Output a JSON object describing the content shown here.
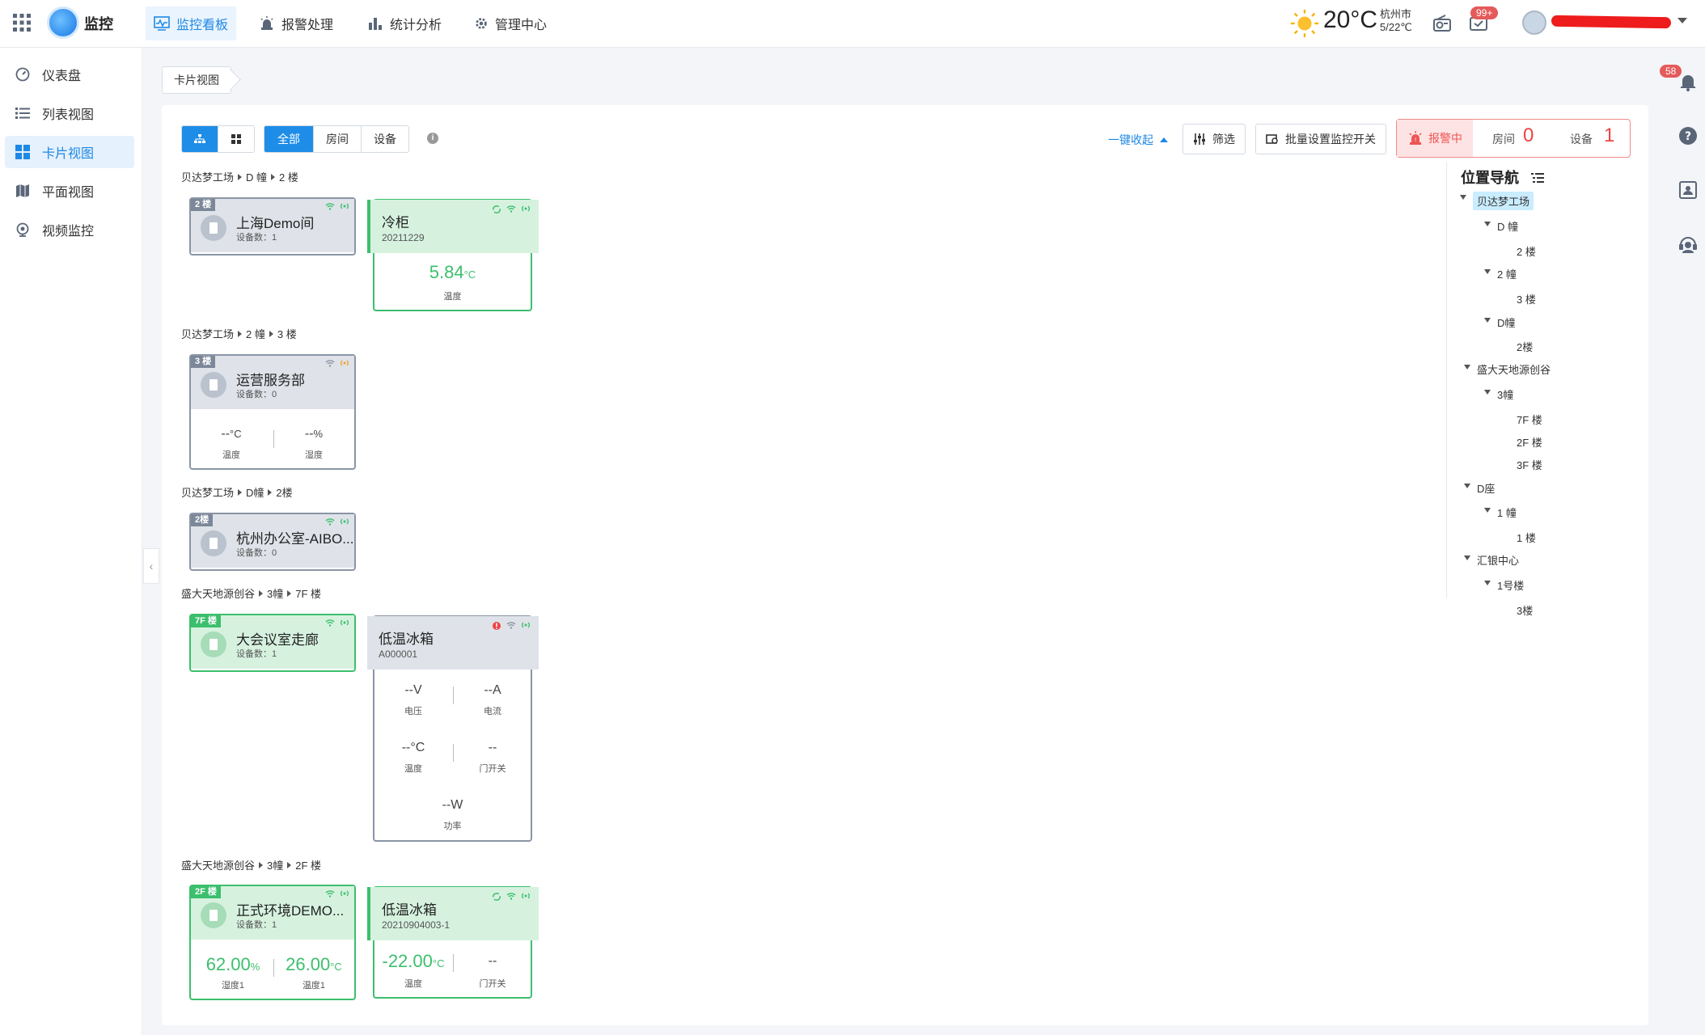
{
  "app": {
    "name": "监控"
  },
  "nav": {
    "items": [
      {
        "label": "监控看板",
        "active": true
      },
      {
        "label": "报警处理"
      },
      {
        "label": "统计分析"
      },
      {
        "label": "管理中心"
      }
    ]
  },
  "weather": {
    "temp": "20°C",
    "city": "杭州市",
    "range": "5/22℃"
  },
  "notifications": {
    "count": "99+",
    "rail_count": "58"
  },
  "sidebar": {
    "items": [
      {
        "label": "仪表盘"
      },
      {
        "label": "列表视图"
      },
      {
        "label": "卡片视图",
        "active": true
      },
      {
        "label": "平面视图"
      },
      {
        "label": "视频监控"
      }
    ]
  },
  "breadcrumb": {
    "tab": "卡片视图"
  },
  "toolbar": {
    "filters": [
      "全部",
      "房间",
      "设备"
    ],
    "collapse_all": "一键收起",
    "filter_btn": "筛选",
    "batch_btn": "批量设置监控开关",
    "alarm": {
      "label": "报警中",
      "room_label": "房间",
      "room_count": "0",
      "device_label": "设备",
      "device_count": "1"
    }
  },
  "groups": [
    {
      "path": [
        "贝达梦工场",
        "D 幢",
        "2 楼"
      ],
      "room": {
        "tag": "2 楼",
        "name": "上海Demo间",
        "devices": "设备数：1"
      },
      "device": {
        "name": "冷柜",
        "id": "20211229",
        "value": "5.84",
        "unit": "°C",
        "label": "温度"
      }
    },
    {
      "path": [
        "贝达梦工场",
        "2 幢",
        "3 楼"
      ],
      "room": {
        "tag": "3 楼",
        "name": "运营服务部",
        "devices": "设备数：0",
        "readings": [
          {
            "value": "--",
            "unit": "°C",
            "label": "温度"
          },
          {
            "value": "--",
            "unit": "%",
            "label": "湿度"
          }
        ]
      }
    },
    {
      "path": [
        "贝达梦工场",
        "D幢",
        "2楼"
      ],
      "room": {
        "tag": "2楼",
        "name": "杭州办公室-AIBO...",
        "devices": "设备数：0"
      }
    },
    {
      "path": [
        "盛大天地源创谷",
        "3幢",
        "7F 楼"
      ],
      "room": {
        "tag": "7F 楼",
        "name": "大会议室走廊",
        "devices": "设备数：1"
      },
      "device": {
        "name": "低温冰箱",
        "id": "A000001",
        "readings": [
          {
            "value": "--V",
            "label": "电压"
          },
          {
            "value": "--A",
            "label": "电流"
          },
          {
            "value": "--°C",
            "label": "温度"
          },
          {
            "value": "--",
            "label": "门开关"
          },
          {
            "value": "--W",
            "label": "功率"
          }
        ]
      }
    },
    {
      "path": [
        "盛大天地源创谷",
        "3幢",
        "2F 楼"
      ],
      "room": {
        "tag": "2F 楼",
        "name": "正式环境DEMO...",
        "devices": "设备数：1",
        "readings": [
          {
            "value": "62.00",
            "unit": "%",
            "label": "湿度1"
          },
          {
            "value": "26.00",
            "unit": "°C",
            "label": "温度1"
          }
        ]
      },
      "device": {
        "name": "低温冰箱",
        "id": "20210904003-1",
        "readings": [
          {
            "value": "-22.00",
            "unit": "°C",
            "label": "温度"
          },
          {
            "value": "--",
            "label": "门开关"
          }
        ]
      }
    }
  ],
  "location_nav": {
    "title": "位置导航",
    "tree": [
      {
        "label": "贝达梦工场",
        "level": 0,
        "selected": true
      },
      {
        "label": "D 幢",
        "level": 1
      },
      {
        "label": "2 楼",
        "level": 2
      },
      {
        "label": "2 幢",
        "level": 1
      },
      {
        "label": "3 楼",
        "level": 2
      },
      {
        "label": "D幢",
        "level": 1
      },
      {
        "label": "2楼",
        "level": 2
      },
      {
        "label": "盛大天地源创谷",
        "level": 0
      },
      {
        "label": "3幢",
        "level": 1
      },
      {
        "label": "7F 楼",
        "level": 2
      },
      {
        "label": "2F 楼",
        "level": 2
      },
      {
        "label": "3F 楼",
        "level": 2
      },
      {
        "label": "D座",
        "level": 0
      },
      {
        "label": "1 幢",
        "level": 1
      },
      {
        "label": "1 楼",
        "level": 2
      },
      {
        "label": "汇银中心",
        "level": 0
      },
      {
        "label": "1号楼",
        "level": 1
      },
      {
        "label": "3楼",
        "level": 2
      }
    ]
  },
  "colors": {
    "accent": "#1e8de8",
    "online": "#3cbf6d",
    "alarm": "#e44444",
    "offline": "#8a95a5"
  }
}
